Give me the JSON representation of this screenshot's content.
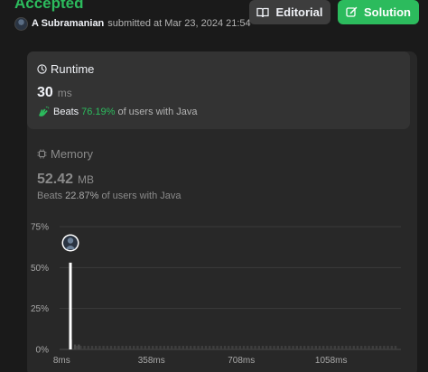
{
  "header": {
    "status": "Accepted",
    "submitter_name": "A Subramanian",
    "submitted_text": "submitted at Mar 23, 2024 21:54"
  },
  "buttons": {
    "editorial_label": "Editorial",
    "solution_label": "Solution"
  },
  "runtime": {
    "title": "Runtime",
    "value": "30",
    "unit": "ms",
    "beats_label": "Beats",
    "beats_percent": "76.19%",
    "beats_tail": "of users with Java"
  },
  "memory": {
    "title": "Memory",
    "value": "52.42",
    "unit": "MB",
    "beats_label": "Beats",
    "beats_percent": "22.87%",
    "beats_tail": "of users with Java"
  },
  "colors": {
    "accent_green": "#2cbb5d",
    "panel": "#282828",
    "card": "#333333"
  },
  "chart_data": {
    "type": "bar",
    "y_ticks": [
      "75%",
      "50%",
      "25%",
      "0%"
    ],
    "y_tick_values": [
      75,
      50,
      25,
      0
    ],
    "x_ticks": [
      "8ms",
      "358ms",
      "708ms",
      "1058ms"
    ],
    "x_tick_values": [
      8,
      358,
      708,
      1058
    ],
    "xlim": [
      0,
      1330
    ],
    "ylim": [
      0,
      75
    ],
    "highlight": {
      "x": 30,
      "y": 53,
      "label": "You"
    },
    "bars": [
      {
        "x": 30,
        "y": 53
      },
      {
        "x": 45,
        "y": 6
      },
      {
        "x": 60,
        "y": 3
      },
      {
        "x": 75,
        "y": 3
      }
    ],
    "grid": true
  }
}
